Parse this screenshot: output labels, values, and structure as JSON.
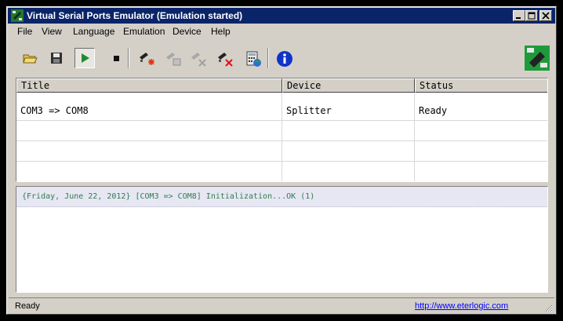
{
  "window": {
    "title": "Virtual Serial Ports Emulator (Emulation started)"
  },
  "menubar": {
    "items": [
      "File",
      "View",
      "Language",
      "Emulation",
      "Device",
      "Help"
    ]
  },
  "toolbar": {
    "icons": [
      "open-folder-icon",
      "save-icon",
      "play-icon",
      "stop-icon",
      "create-device-icon",
      "edit-device-icon",
      "remove-device-icon",
      "delete-device-icon",
      "calculator-icon",
      "globe-icon",
      "info-icon",
      "device-brand-icon"
    ],
    "play_active": true
  },
  "devices": {
    "columns": [
      "Title",
      "Device",
      "Status"
    ],
    "rows": [
      {
        "title": "COM3 => COM8",
        "device": "Splitter",
        "status": "Ready"
      }
    ]
  },
  "log": {
    "entries": [
      "{Friday, June 22, 2012} [COM3 => COM8] Initialization...OK (1)"
    ]
  },
  "statusbar": {
    "text": "Ready",
    "link": "http://www.eterlogic.com"
  },
  "colors": {
    "titlebar": "#0a246a",
    "log_text": "#2e7d4f",
    "link": "#0000ff",
    "log_row_bg": "#e7e7f3"
  }
}
